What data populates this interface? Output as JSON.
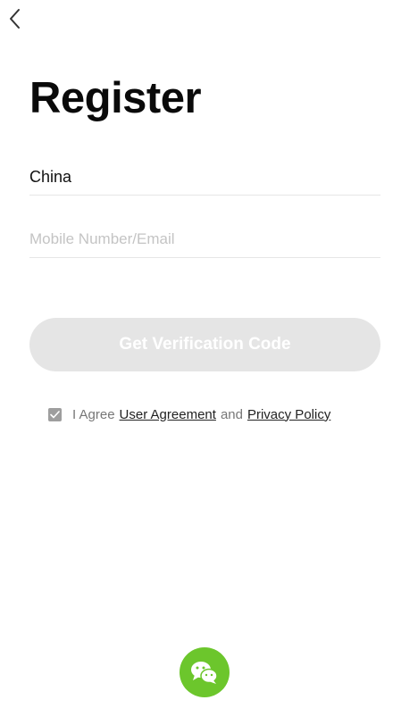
{
  "nav": {
    "back_icon": "chevron-left-icon"
  },
  "page": {
    "title": "Register"
  },
  "form": {
    "country_value": "China",
    "account_placeholder": "Mobile Number/Email",
    "account_value": "",
    "submit_label": "Get Verification Code",
    "submit_enabled": false
  },
  "agreement": {
    "checked": true,
    "prefix": "I Agree",
    "user_agreement": "User Agreement",
    "and": "and",
    "privacy_policy": "Privacy Policy"
  },
  "social": {
    "wechat_icon": "wechat-icon"
  },
  "colors": {
    "wechat_green": "#6cc62c",
    "button_disabled_bg": "#e5e5e5",
    "checkbox_fill": "#9e9e9e",
    "divider": "#e6e6e6"
  }
}
